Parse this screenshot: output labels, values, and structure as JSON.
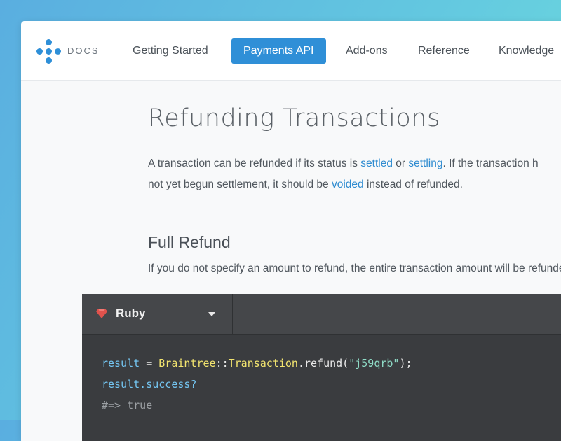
{
  "header": {
    "brand": "DOCS",
    "tabs": [
      {
        "label": "Getting Started",
        "active": false
      },
      {
        "label": "Payments API",
        "active": true
      },
      {
        "label": "Add-ons",
        "active": false
      },
      {
        "label": "Reference",
        "active": false
      },
      {
        "label": "Knowledge",
        "active": false
      }
    ]
  },
  "article": {
    "title": "Refunding Transactions",
    "intro": {
      "p1": "A transaction can be refunded if its status is ",
      "link_settled": "settled",
      "p2": " or ",
      "link_settling": "settling",
      "p3": ". If the transaction h",
      "p4": "not yet begun settlement, it should be ",
      "link_voided": "voided",
      "p5": " instead of refunded."
    },
    "full_refund": {
      "heading": "Full Refund",
      "body": "If you do not specify an amount to refund, the entire transaction amount will be refunded."
    }
  },
  "code_block": {
    "language": "Ruby",
    "line1": {
      "var": "result",
      "op": " = ",
      "const1": "Braintree",
      "sep": "::",
      "const2": "Transaction",
      "call": ".refund(",
      "str": "\"j59qrb\"",
      "end": ");"
    },
    "line2": "result.success?",
    "line3": "#=> true"
  },
  "colors": {
    "accent": "#2f8fd7",
    "link": "#2e8bd0",
    "code_bg": "#3a3c3f",
    "ruby_red": "#e0524c"
  }
}
